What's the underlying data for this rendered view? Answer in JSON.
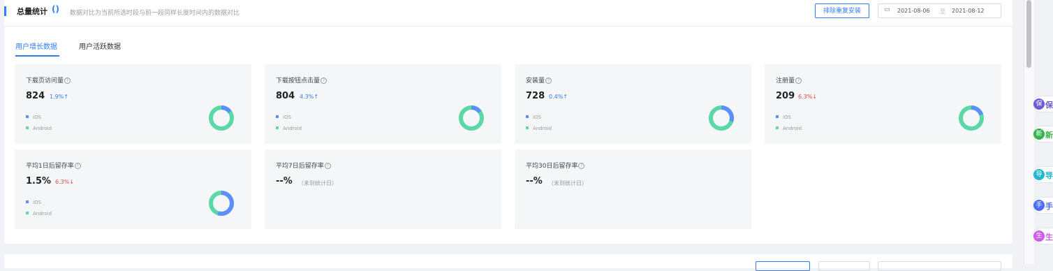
{
  "header": {
    "title": "总量统计",
    "spinner": "()",
    "description": "数据对比为当前所选时段与前一段同样长度时间内的数据对比",
    "exclude_button": "排除重复安装",
    "date_start": "2021-08-06",
    "date_sep": "至",
    "date_end": "2021-08-12"
  },
  "tabs": [
    {
      "label": "用户增长数据",
      "active": true
    },
    {
      "label": "用户活跃数据",
      "active": false
    }
  ],
  "colors": {
    "accent": "#2f7cf6",
    "ios": "#5b8ff9",
    "android": "#5ad8a6",
    "down": "#e84545"
  },
  "legend": {
    "ios": "iOS",
    "android": "Android"
  },
  "cards": [
    {
      "title": "下载页访问量",
      "value": "824",
      "change": "1.9%",
      "trend": "up",
      "arrow": "↑",
      "ios_share": 0.15
    },
    {
      "title": "下载按钮点击量",
      "value": "804",
      "change": "4.3%",
      "trend": "up",
      "arrow": "↑",
      "ios_share": 0.15
    },
    {
      "title": "安装量",
      "value": "728",
      "change": "0.4%",
      "trend": "up",
      "arrow": "↑",
      "ios_share": 0.3
    },
    {
      "title": "注册量",
      "value": "209",
      "change": "6.3%",
      "trend": "down",
      "arrow": "↓",
      "ios_share": 0.2
    },
    {
      "title": "平均1日后留存率",
      "value": "1.5%",
      "change": "6.3%",
      "trend": "down",
      "arrow": "↓",
      "ios_share": 0.55
    },
    {
      "title": "平均7日后留存率",
      "value": "--%",
      "note": "（未到统计日）"
    },
    {
      "title": "平均30日后留存率",
      "value": "--%",
      "note": "（未到统计日）"
    }
  ],
  "side_items": [
    {
      "icon": "保",
      "label": "保",
      "color": "#6b5bd6"
    },
    {
      "icon": "新",
      "label": "新",
      "color": "#37b24d"
    },
    {
      "icon": "导",
      "label": "导",
      "color": "#22b8cf"
    },
    {
      "icon": "手",
      "label": "手",
      "color": "#4c6ef5"
    },
    {
      "icon": "生",
      "label": "生",
      "color": "#cc5de8"
    }
  ]
}
